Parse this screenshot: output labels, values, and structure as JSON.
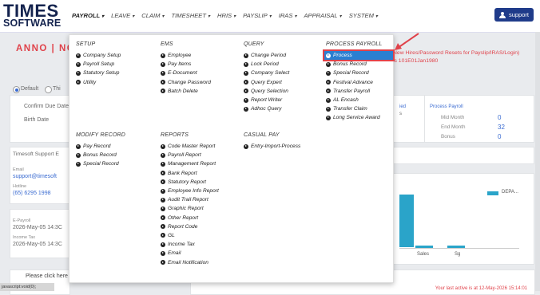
{
  "logo": {
    "line1": "TIMES",
    "line2": "SOFTWARE"
  },
  "nav": [
    {
      "label": "PAYROLL",
      "active": true
    },
    {
      "label": "LEAVE"
    },
    {
      "label": "CLAIM"
    },
    {
      "label": "TIMESHEET"
    },
    {
      "label": "HRIS"
    },
    {
      "label": "PAYSLIP"
    },
    {
      "label": "IRAS"
    },
    {
      "label": "APPRAISAL"
    },
    {
      "label": "SYSTEM"
    }
  ],
  "support_label": "support",
  "background": {
    "title": "ANNO | NCE",
    "red_notice_1": "New Hires/Password Resets for Payslip/IRAS/Login)",
    "red_notice_2": "is 101E01Jan1980",
    "radio_default": "Default",
    "radio_other": "Thi",
    "confirm_due": "Confirm Due Date",
    "birth_date": "Birth Date",
    "support_header": "Timesoft Support E",
    "email_label": "Email",
    "email_value": "support@timesoft",
    "hotline_label": "Hotline",
    "hotline_value": "(65) 6295 1998",
    "epayroll_label": "E-Payroll",
    "epayroll_value": "2026-May-05 14:3C",
    "incometax_label": "Income Tax",
    "incometax_value": "2026-May-05 14:3C",
    "frag_ied": "ied",
    "frag_s": "s",
    "click_note": "Please click here to view release note.",
    "bottom_red": "Your last active is at 12-May-2026 15:14:01",
    "status_text": "javascript:void(0);",
    "process_payroll_title": "Process Payroll",
    "pp_rows": [
      {
        "label": "Mid Month",
        "value": "0"
      },
      {
        "label": "End Month",
        "value": "32"
      },
      {
        "label": "Bonus",
        "value": "0"
      }
    ],
    "chart": {
      "legend": "DEPA...",
      "xlabels": [
        "Sales",
        "Sg"
      ]
    }
  },
  "menu": {
    "setup": {
      "header": "SETUP",
      "items": [
        "Company Setup",
        "Payroll Setup",
        "Statutory Setup",
        "Utility"
      ]
    },
    "ems": {
      "header": "EMS",
      "items": [
        "Employee",
        "Pay Items",
        "E-Document",
        "Change Password",
        "Batch Delete"
      ]
    },
    "query": {
      "header": "QUERY",
      "items": [
        "Change Period",
        "Lock Period",
        "Company Select",
        "Query Expert",
        "Query Selection",
        "Report Writer",
        "Adhoc Query"
      ]
    },
    "process_payroll": {
      "header": "PROCESS PAYROLL",
      "items": [
        "Process",
        "Bonus Record",
        "Special Record",
        "Festival Advance",
        "Transfer Payroll",
        "AL Encash",
        "Transfer Claim",
        "Long Service Award"
      ]
    },
    "modify_record": {
      "header": "MODIFY RECORD",
      "items": [
        "Pay Record",
        "Bonus Record",
        "Special Record"
      ]
    },
    "reports": {
      "header": "REPORTS",
      "items": [
        "Code Master Report",
        "Payroll Report",
        "Management Report",
        "Bank Report",
        "Statutory Report",
        "Employee Info Report",
        "Audit Trail Report",
        "Graphic Report",
        "Other Report",
        "Report Code",
        "GL",
        "Income Tax",
        "Email",
        "Email Notification"
      ]
    },
    "casual_pay": {
      "header": "CASUAL PAY",
      "items": [
        "Entry-Import-Process"
      ]
    }
  },
  "colors": {
    "highlight": "#2b7fd1",
    "annotation": "#e0424a",
    "brand": "#14234e",
    "bar": "#2aa4c9"
  }
}
